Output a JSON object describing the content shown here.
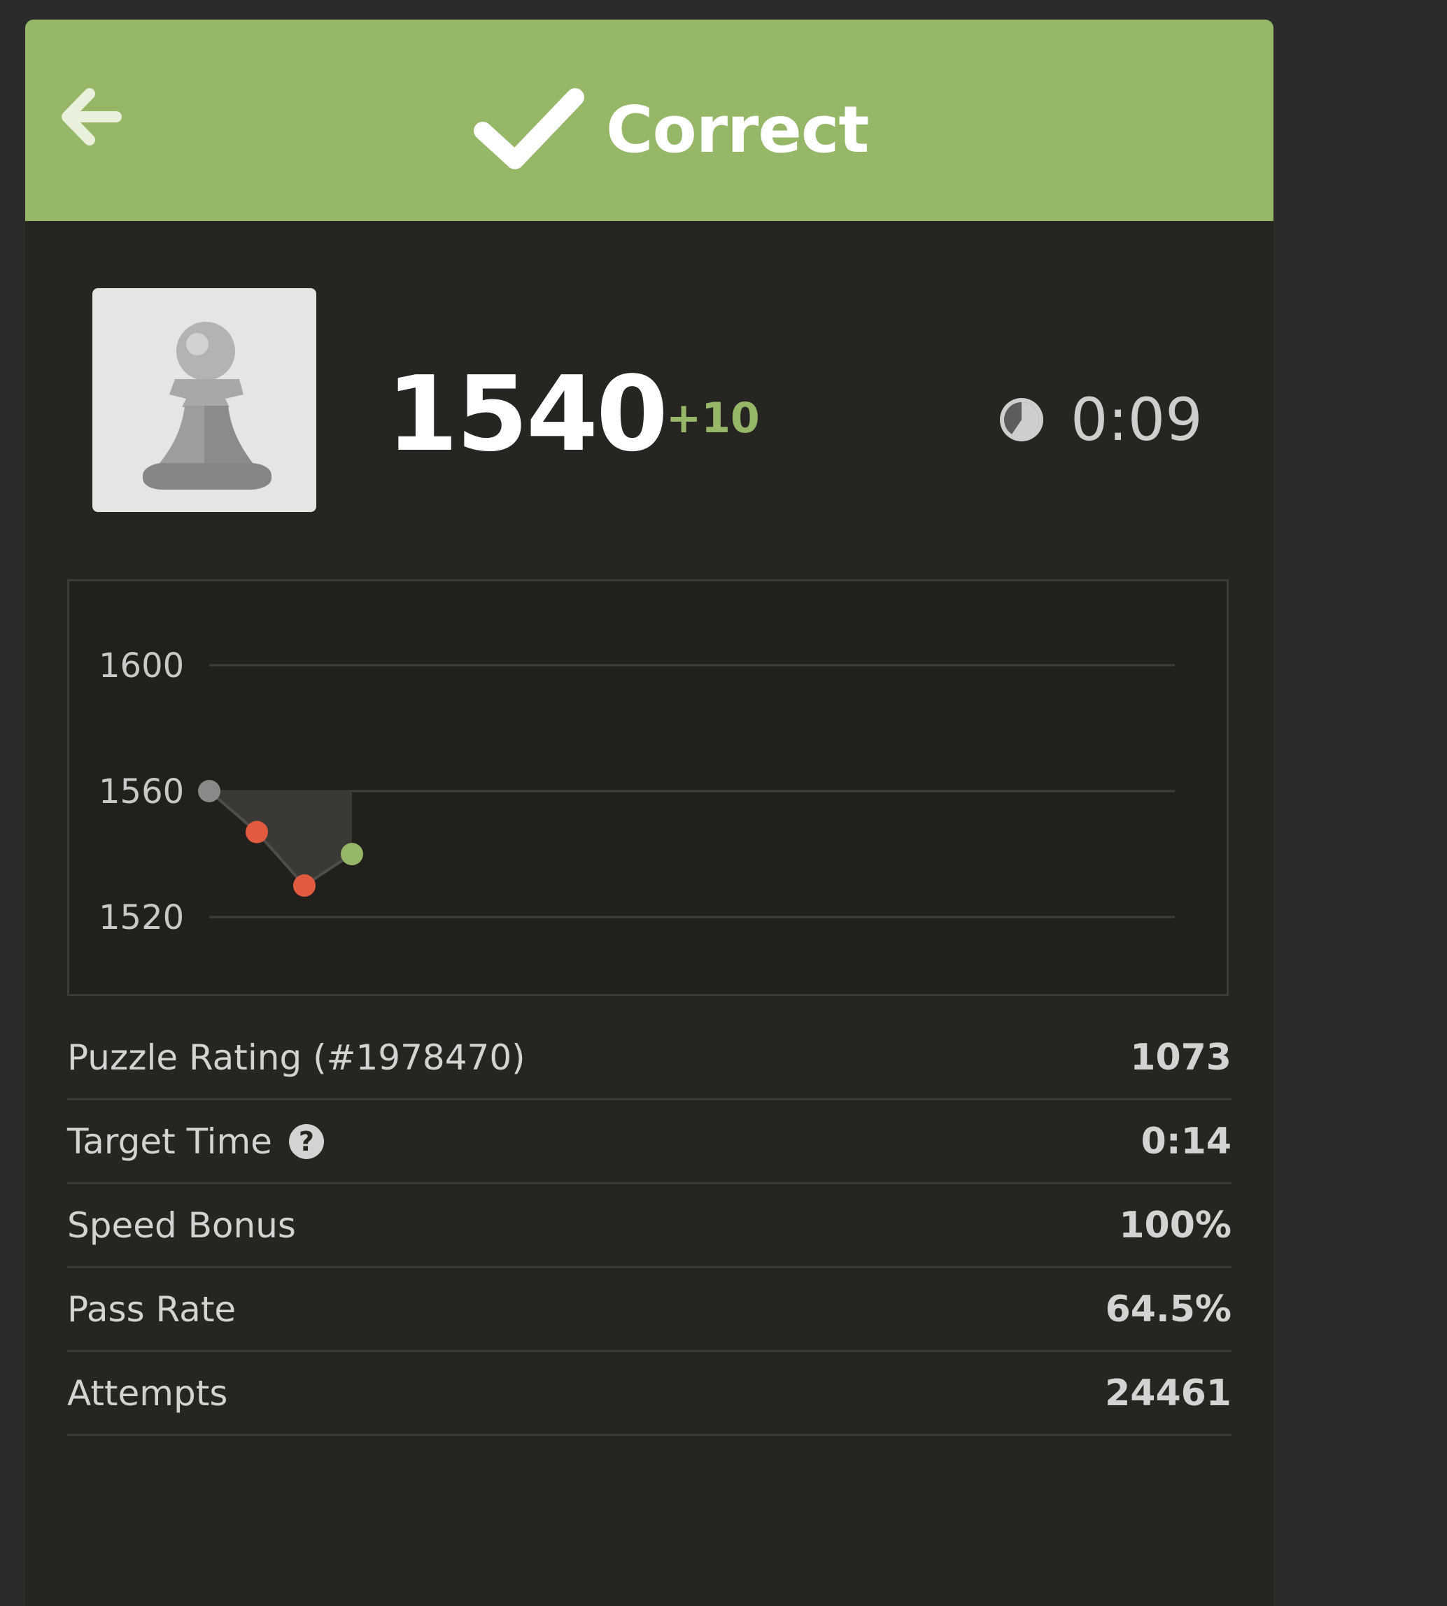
{
  "header": {
    "title": "Correct",
    "back_icon": "arrow-left-icon",
    "status_icon": "checkmark-icon",
    "color": "#96b668"
  },
  "player": {
    "avatar_icon": "pawn-icon",
    "rating": "1540",
    "rating_change": "+10",
    "timer_icon": "clock-icon",
    "time": "0:09"
  },
  "chart_data": {
    "type": "line",
    "y_ticks": [
      "1600",
      "1560",
      "1520"
    ],
    "ylim": [
      1500,
      1620
    ],
    "grid": true,
    "points": [
      {
        "x": 1,
        "y": 1560,
        "result": "start",
        "color": "#8a8987"
      },
      {
        "x": 2,
        "y": 1547,
        "result": "failed",
        "color": "#e35b3f"
      },
      {
        "x": 3,
        "y": 1530,
        "result": "failed",
        "color": "#e35b3f"
      },
      {
        "x": 4,
        "y": 1540,
        "result": "correct",
        "color": "#96b668"
      }
    ]
  },
  "stats": [
    {
      "label": "Puzzle Rating (#1978470)",
      "value": "1073"
    },
    {
      "label": "Target Time",
      "value": "0:14",
      "help_icon": "question-mark-icon",
      "help_glyph": "?"
    },
    {
      "label": "Speed Bonus",
      "value": "100%"
    },
    {
      "label": "Pass Rate",
      "value": "64.5%"
    },
    {
      "label": "Attempts",
      "value": "24461"
    }
  ]
}
